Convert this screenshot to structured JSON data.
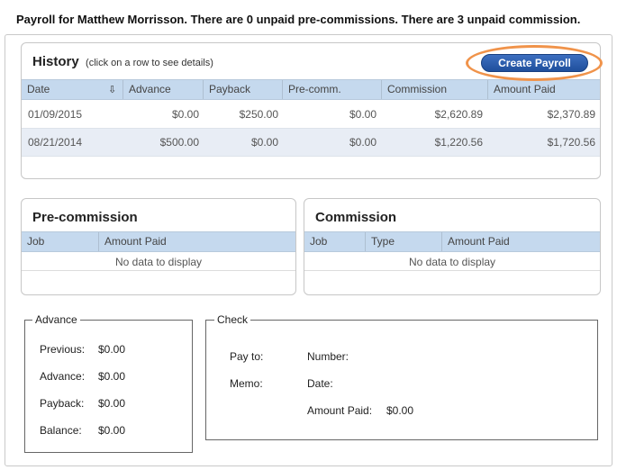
{
  "header": {
    "text": "Payroll for Matthew Morrisson. There are 0 unpaid pre-commissions. There are 3 unpaid commission."
  },
  "history": {
    "title": "History",
    "subtitle": "(click on a row to see details)",
    "create_button": "Create Payroll",
    "columns": [
      "Date",
      "Advance",
      "Payback",
      "Pre-comm.",
      "Commission",
      "Amount Paid"
    ],
    "sort_icon": "sort-down-arrow-icon",
    "rows": [
      {
        "date": "01/09/2015",
        "advance": "$0.00",
        "payback": "$250.00",
        "precomm": "$0.00",
        "commission": "$2,620.89",
        "amount_paid": "$2,370.89"
      },
      {
        "date": "08/21/2014",
        "advance": "$500.00",
        "payback": "$0.00",
        "precomm": "$0.00",
        "commission": "$1,220.56",
        "amount_paid": "$1,720.56"
      }
    ]
  },
  "precommission": {
    "title": "Pre-commission",
    "columns": [
      "Job",
      "Amount Paid"
    ],
    "empty": "No data to display"
  },
  "commission": {
    "title": "Commission",
    "columns": [
      "Job",
      "Type",
      "Amount Paid"
    ],
    "empty": "No data to display"
  },
  "advance": {
    "legend": "Advance",
    "previous_label": "Previous:",
    "previous_value": "$0.00",
    "advance_label": "Advance:",
    "advance_value": "$0.00",
    "payback_label": "Payback:",
    "payback_value": "$0.00",
    "balance_label": "Balance:",
    "balance_value": "$0.00"
  },
  "check": {
    "legend": "Check",
    "pay_to_label": "Pay to:",
    "memo_label": "Memo:",
    "number_label": "Number:",
    "date_label": "Date:",
    "amount_paid_label": "Amount Paid:",
    "amount_paid_value": "$0.00"
  },
  "colors": {
    "accent": "#2a5caa",
    "highlight_ring": "#f0934a",
    "grid_header": "#c5d9ee",
    "alt_row": "#e8edf5"
  }
}
